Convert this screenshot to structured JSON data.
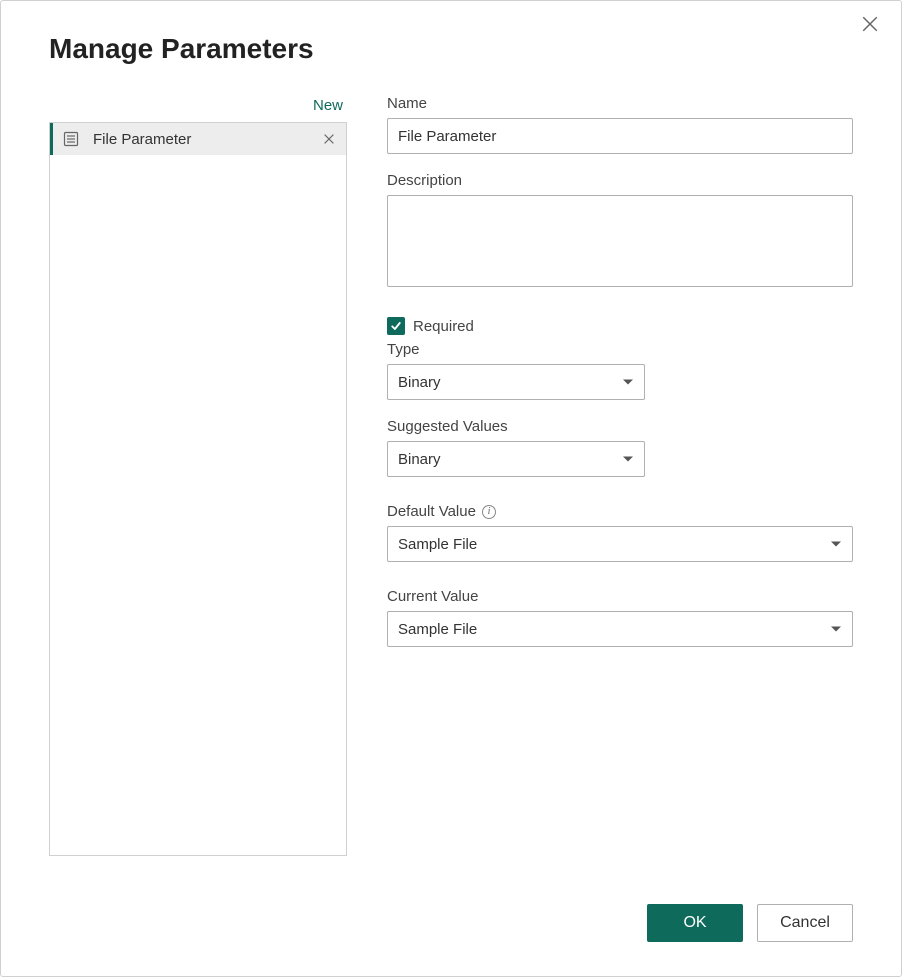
{
  "dialog": {
    "title": "Manage Parameters",
    "close_label": "Close"
  },
  "sidebar": {
    "new_label": "New",
    "items": [
      {
        "label": "File Parameter"
      }
    ]
  },
  "form": {
    "name_label": "Name",
    "name_value": "File Parameter",
    "description_label": "Description",
    "description_value": "",
    "required_label": "Required",
    "required_checked": true,
    "type_label": "Type",
    "type_value": "Binary",
    "suggested_label": "Suggested Values",
    "suggested_value": "Binary",
    "default_label": "Default Value",
    "default_value": "Sample File",
    "current_label": "Current Value",
    "current_value": "Sample File"
  },
  "footer": {
    "ok_label": "OK",
    "cancel_label": "Cancel"
  }
}
